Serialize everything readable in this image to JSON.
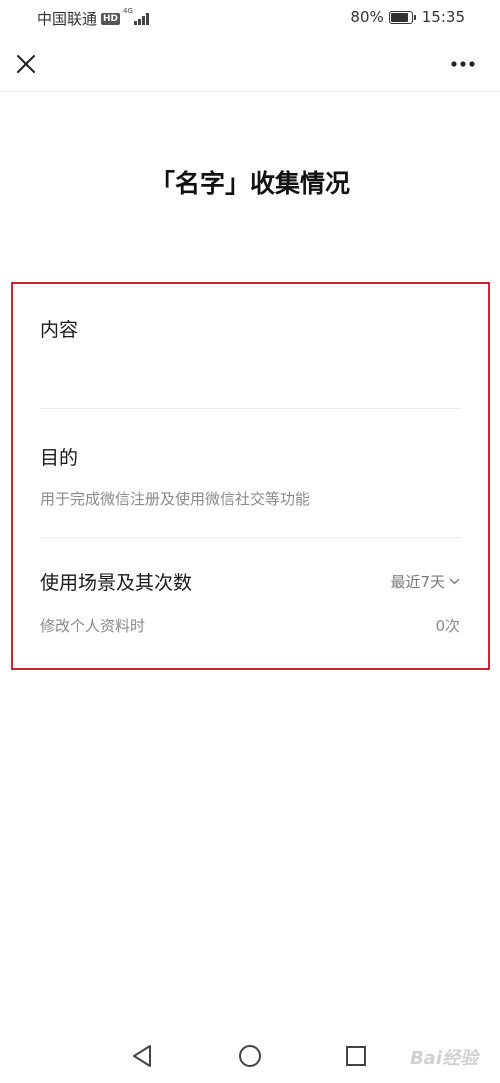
{
  "status_bar": {
    "carrier": "中国联通",
    "hd_badge": "HD",
    "network_type": "4G",
    "battery_percent": "80%",
    "battery_level": 0.8,
    "time": "15:35"
  },
  "nav": {
    "close_icon": "close-icon",
    "more_icon": "more-dots-icon"
  },
  "page": {
    "title": "「名字」收集情况"
  },
  "sections": {
    "content": {
      "title": "内容",
      "value": ""
    },
    "purpose": {
      "title": "目的",
      "description": "用于完成微信注册及使用微信社交等功能"
    },
    "usage": {
      "title": "使用场景及其次数",
      "period_label": "最近7天",
      "items": [
        {
          "label": "修改个人资料时",
          "count": "0次"
        }
      ]
    }
  },
  "system_nav": {
    "back_icon": "back-triangle-icon",
    "home_icon": "home-circle-icon",
    "recent_icon": "recent-square-icon"
  },
  "watermark": "Bai经验",
  "colors": {
    "highlight_border": "#d0232f",
    "secondary_text": "#8a8a8a"
  }
}
